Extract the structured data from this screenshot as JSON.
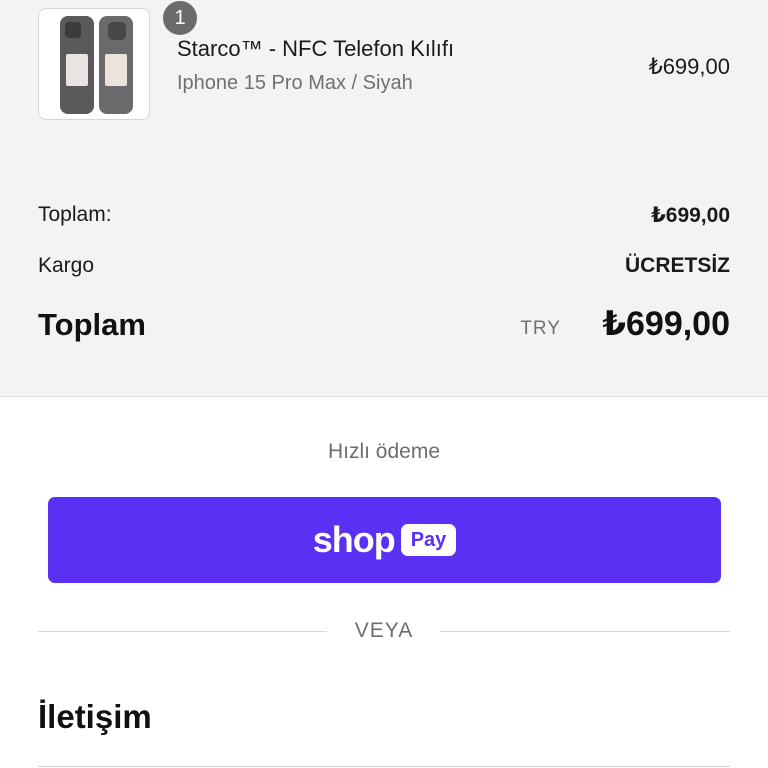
{
  "cart": {
    "item": {
      "quantity": "1",
      "name": "Starco™ - NFC Telefon Kılıfı",
      "variant": "Iphone 15 Pro Max / Siyah",
      "price": "₺699,00"
    }
  },
  "summary": {
    "subtotal_label": "Toplam:",
    "subtotal_value": "₺699,00",
    "shipping_label": "Kargo",
    "shipping_value": "ÜCRETSİZ",
    "total_label": "Toplam",
    "total_currency": "TRY",
    "total_value": "₺699,00"
  },
  "express": {
    "label": "Hızlı ödeme",
    "shop_word": "shop",
    "pay_word": "Pay",
    "divider": "VEYA"
  },
  "contact": {
    "heading": "İletişim"
  },
  "colors": {
    "shop_pay": "#5a31f4",
    "summary_bg": "#f3f3f3"
  }
}
